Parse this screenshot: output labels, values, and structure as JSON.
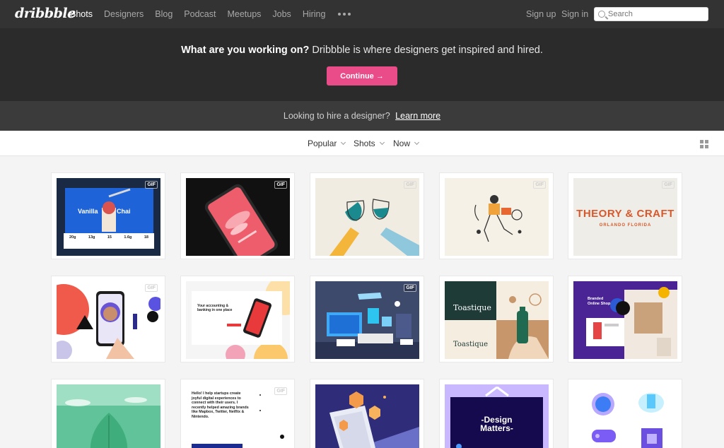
{
  "nav": {
    "logo": "dribbble",
    "links": [
      "Shots",
      "Designers",
      "Blog",
      "Podcast",
      "Meetups",
      "Jobs",
      "Hiring"
    ],
    "sign_up": "Sign up",
    "sign_in": "Sign in",
    "search_placeholder": "Search"
  },
  "hero": {
    "bold": "What are you working on?",
    "text": "Dribbble is where designers get inspired and hired.",
    "button": "Continue →"
  },
  "hire": {
    "text": "Looking to hire a designer?",
    "link": "Learn more"
  },
  "filters": {
    "popular": "Popular",
    "shots": "Shots",
    "now": "Now"
  },
  "shots": {
    "s1": {
      "gif": "GIF",
      "title_left": "Vanilla",
      "title_right": "Chai",
      "stats": [
        "20g",
        "13g",
        "15",
        "1.6g",
        "18"
      ]
    },
    "s2": {
      "gif": "GIF"
    },
    "s3": {
      "gif": "GIF"
    },
    "s4": {
      "gif": "GIF"
    },
    "s5": {
      "gif": "GIF",
      "title": "THEORY & CRAFT",
      "subtitle": "ORLANDO FLORIDA"
    },
    "s6": {
      "gif": "GIF"
    },
    "s7": {
      "headline": "Your accounting & banking in one place"
    },
    "s8": {
      "gif": "GIF"
    },
    "s9": {
      "brand": "Toastique"
    },
    "s10": {
      "title": "Branded Online Shop"
    },
    "s12": {
      "gif": "GIF",
      "text": "Hello! I help startups create joyful digital experiences to connect with their users. I recently helped amazing brands like Mapbox, Twitter, Netflix & Nintendo."
    },
    "s14": {
      "title": "-Design Matters-"
    }
  },
  "colors": {
    "accent": "#ea4c89",
    "nav_bg": "#333333",
    "hero_bg": "#2b2b2b"
  }
}
